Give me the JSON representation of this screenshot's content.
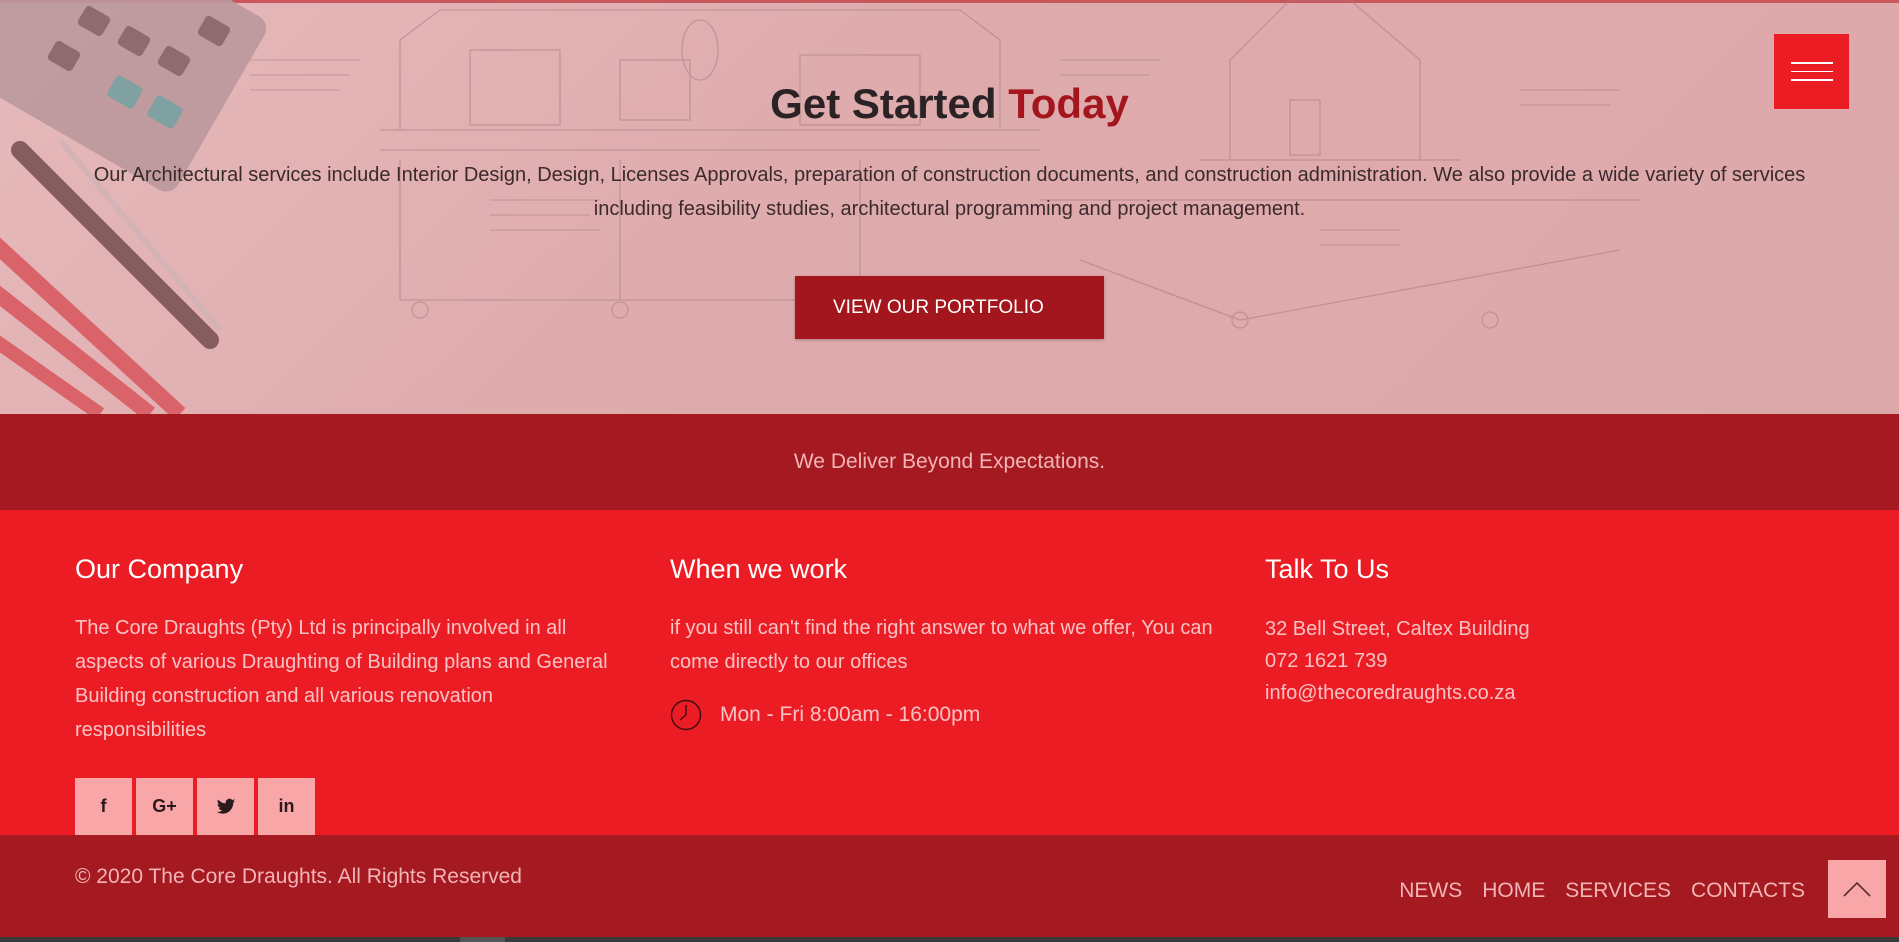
{
  "hero": {
    "title_main": "Get Started",
    "title_accent": "Today",
    "description": "Our Architectural services include Interior Design, Design, Licenses Approvals, preparation of construction documents, and construction administration. We also provide a wide variety of services including feasibility studies, architectural programming and project management.",
    "button_label": "VIEW OUR PORTFOLIO"
  },
  "tagline": "We Deliver Beyond Expectations.",
  "footer": {
    "company": {
      "heading": "Our Company",
      "text": "The Core Draughts (Pty) Ltd is principally involved in all aspects of various Draughting of Building plans and General Building construction and all various renovation responsibilities"
    },
    "work": {
      "heading": "When we work",
      "text": "if you still can't find the right answer to what we offer, You can come directly to our offices",
      "hours": "Mon - Fri 8:00am - 16:00pm"
    },
    "contact": {
      "heading": "Talk To Us",
      "address": "32 Bell Street, Caltex Building",
      "phone": "072 1621 739",
      "email": "info@thecoredraughts.co.za"
    },
    "social": [
      {
        "icon": "facebook-icon",
        "glyph": "f"
      },
      {
        "icon": "google-plus-icon",
        "glyph": "G+"
      },
      {
        "icon": "twitter-icon",
        "glyph": "🐦"
      },
      {
        "icon": "linkedin-icon",
        "glyph": "in"
      }
    ]
  },
  "bottom": {
    "copyright": "© 2020 The Core Draughts. All Rights Reserved",
    "nav": [
      "NEWS",
      "HOME",
      "SERVICES",
      "CONTACTS"
    ]
  },
  "colors": {
    "accent": "#ec1c24",
    "dark_red": "#a41a20",
    "pink": "#f8a6a8"
  }
}
